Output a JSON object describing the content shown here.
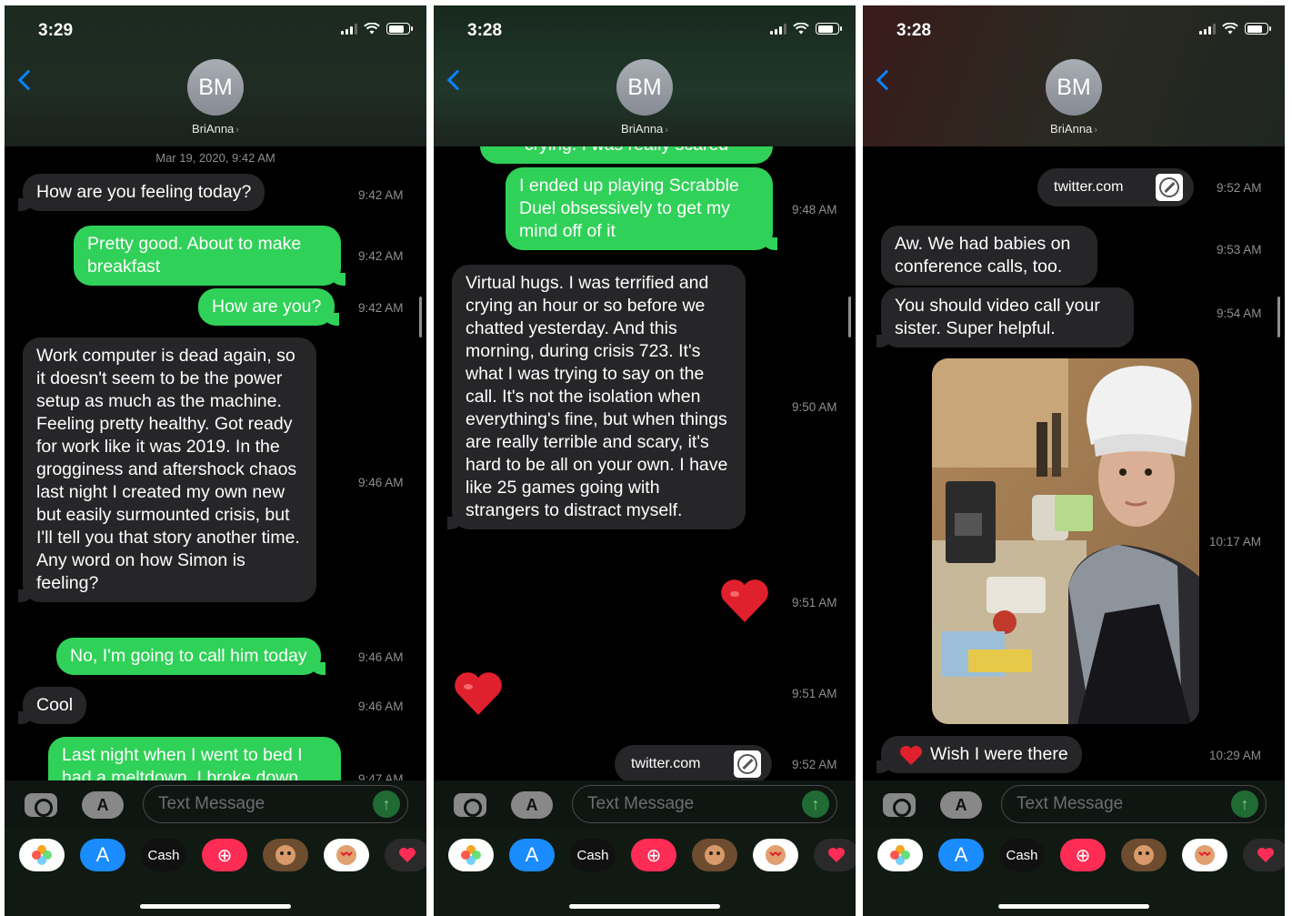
{
  "contact": {
    "initials": "BM",
    "name": "BriAnna",
    "chevron": "›"
  },
  "ui": {
    "text_placeholder": "Text Message",
    "cash_label": "Cash"
  },
  "colors": {
    "sent": "#30d158",
    "received": "#262628",
    "accent": "#0a84ff",
    "heart": "#e0202c"
  },
  "screens": [
    {
      "time": "3:29",
      "date_header": "Mar 19, 2020, 9:42 AM",
      "messages": [
        {
          "from": "them",
          "text": "How are you feeling today?",
          "time": "9:42 AM"
        },
        {
          "from": "me",
          "text": "Pretty good. About to make breakfast",
          "time": "9:42 AM"
        },
        {
          "from": "me",
          "text": "How are you?",
          "time": "9:42 AM"
        },
        {
          "from": "them",
          "text": "Work computer is dead again, so it doesn't seem to be the power setup as much as the machine. Feeling pretty healthy. Got ready for work like it was 2019. In the grogginess and aftershock chaos last night I created my own new but easily surmounted crisis, but I'll tell you that story another time. Any word on how Simon is feeling?",
          "time": "9:46 AM"
        },
        {
          "from": "me",
          "text": "No, I'm going to call him today",
          "time": "9:46 AM"
        },
        {
          "from": "them",
          "text": "Cool",
          "time": "9:46 AM"
        },
        {
          "from": "me",
          "text": "Last night when I went to bed I had a meltdown. I broke down",
          "time": "9:47 AM"
        }
      ]
    },
    {
      "time": "3:28",
      "messages": [
        {
          "from": "me",
          "text": "crying. I was really scared",
          "time": ""
        },
        {
          "from": "me",
          "text": "I ended up playing Scrabble Duel obsessively to get my mind off of it",
          "time": "9:48 AM"
        },
        {
          "from": "them",
          "text": "Virtual hugs. I was terrified and crying an hour or so before we chatted yesterday. And this morning, during crisis 723. It's what I was trying to say on the call. It's not the isolation when everything's fine, but when things are really terrible and scary, it's hard to be all on your own. I have like 25 games going with strangers to distract myself.",
          "time": "9:50 AM"
        },
        {
          "from": "me",
          "kind": "heart",
          "time": "9:51 AM"
        },
        {
          "from": "them",
          "kind": "heart",
          "time": "9:51 AM"
        },
        {
          "from": "me",
          "kind": "link",
          "text": "twitter.com",
          "time": "9:52 AM"
        }
      ]
    },
    {
      "time": "3:28",
      "messages": [
        {
          "from": "me",
          "kind": "link",
          "text": "twitter.com",
          "time": "9:52 AM"
        },
        {
          "from": "them",
          "text": "Aw. We had babies on conference calls, too.",
          "time": "9:53 AM"
        },
        {
          "from": "them",
          "text": "You should video call your sister. Super helpful.",
          "time": "9:54 AM"
        },
        {
          "from": "me",
          "kind": "photo",
          "time": "10:17 AM"
        },
        {
          "from": "them",
          "text": "Wish I were there",
          "reaction": "heart",
          "time": "10:29 AM"
        }
      ]
    }
  ]
}
